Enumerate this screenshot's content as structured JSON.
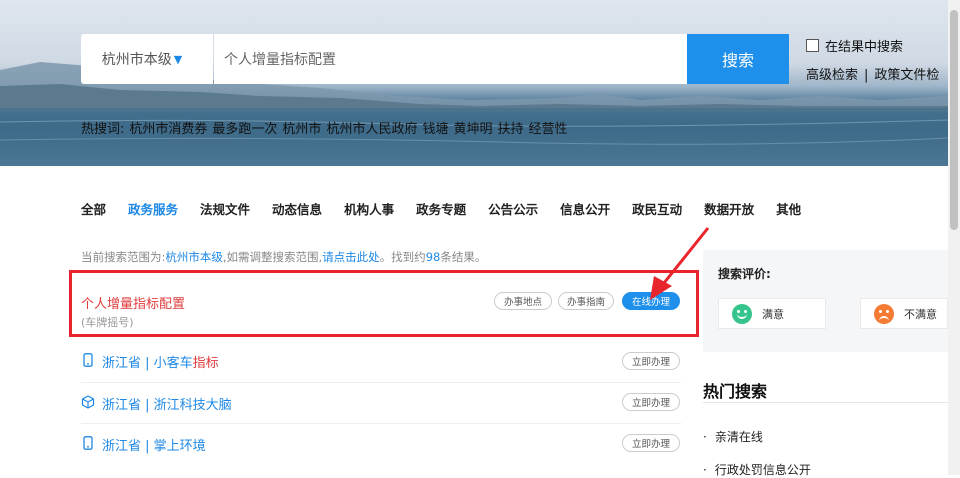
{
  "search": {
    "city": "杭州市本级",
    "query": "个人增量指标配置",
    "button": "搜索",
    "in_results_label": "在结果中搜索",
    "advanced": "高级检索",
    "separator": "|",
    "policy_docs": "政策文件检"
  },
  "hot_words": {
    "label": "热搜词:",
    "items": [
      "杭州市消费券",
      "最多跑一次",
      "杭州市",
      "杭州市人民政府",
      "钱塘",
      "黄坤明",
      "扶持",
      "经营性"
    ]
  },
  "tabs": [
    {
      "label": "全部",
      "active": false
    },
    {
      "label": "政务服务",
      "active": true
    },
    {
      "label": "法规文件",
      "active": false
    },
    {
      "label": "动态信息",
      "active": false
    },
    {
      "label": "机构人事",
      "active": false
    },
    {
      "label": "政务专题",
      "active": false
    },
    {
      "label": "公告公示",
      "active": false
    },
    {
      "label": "信息公开",
      "active": false
    },
    {
      "label": "政民互动",
      "active": false
    },
    {
      "label": "数据开放",
      "active": false
    },
    {
      "label": "其他",
      "active": false
    }
  ],
  "scope": {
    "prefix": "当前搜索范围为:",
    "area": "杭州市本级",
    "mid": ",如需调整搜索范围,",
    "link": "请点击此处",
    "found_prefix": "。找到约",
    "count": "98",
    "found_suffix": "条结果。"
  },
  "results": {
    "main": {
      "title": "个人增量指标配置",
      "subtitle": "(车牌摇号)",
      "actions": [
        "办事地点",
        "办事指南",
        "在线办理"
      ]
    },
    "rows": [
      {
        "icon": "mobile-icon",
        "prefix": "浙江省 | 小客车",
        "keyword": "指标",
        "action": "立即办理"
      },
      {
        "icon": "cube-icon",
        "prefix": "浙江省 | 浙江科技大脑",
        "keyword": "",
        "action": "立即办理"
      },
      {
        "icon": "mobile-icon",
        "prefix": "浙江省 | 掌上环境",
        "keyword": "",
        "action": "立即办理"
      }
    ]
  },
  "evaluation": {
    "title": "搜索评价:",
    "satisfied": "满意",
    "unsatisfied": "不满意"
  },
  "hot_search": {
    "title": "热门搜索",
    "items": [
      "亲清在线",
      "行政处罚信息公开"
    ]
  },
  "colors": {
    "accent": "#1e8fea",
    "highlight_red": "#e03c3c",
    "annotation_red": "#e8242c"
  }
}
